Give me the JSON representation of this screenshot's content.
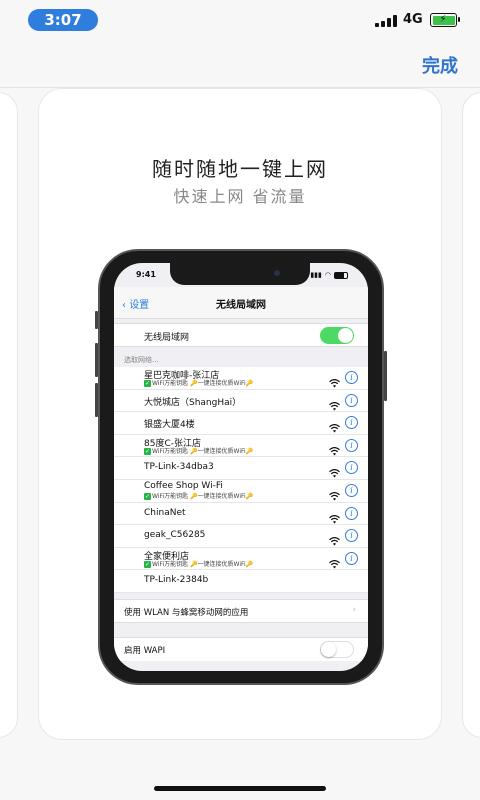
{
  "status_bar": {
    "time": "3:07",
    "network": "4G",
    "battery_color": "#3cc24a"
  },
  "nav": {
    "done_label": "完成",
    "accent": "#3174cc"
  },
  "card": {
    "title": "随时随地一键上网",
    "subtitle": "快速上网 省流量"
  },
  "phone": {
    "time": "9:41",
    "back_label": "设置",
    "title": "无线局域网",
    "wlan_label": "无线局域网",
    "choose_label": "选取网络...",
    "networks": [
      {
        "name": "星巴克咖啡-张江店",
        "sub": "WiFi万能钥匙 🔑一键连接优质WiFi🔑"
      },
      {
        "name": "大悦城店（ShangHai）",
        "sub": ""
      },
      {
        "name": "银盛大厦4楼",
        "sub": ""
      },
      {
        "name": "85度C-张江店",
        "sub": "WiFi万能钥匙 🔑一键连接优质WiFi🔑"
      },
      {
        "name": "TP-Link-34dba3",
        "sub": ""
      },
      {
        "name": "Coffee Shop Wi-Fi",
        "sub": "WiFi万能钥匙 🔑一键连接优质WiFi🔑"
      },
      {
        "name": "ChinaNet",
        "sub": ""
      },
      {
        "name": "geak_C56285",
        "sub": ""
      },
      {
        "name": "全家便利店",
        "sub": "WiFi万能钥匙 🔑一键连接优质WiFi🔑"
      },
      {
        "name": "TP-Link-2384b",
        "sub": ""
      }
    ],
    "apps_label": "使用 WLAN 与蜂窝移动网的应用",
    "wapi_label": "启用 WAPI",
    "info_glyph": "i",
    "chevron_glyph": "›"
  }
}
